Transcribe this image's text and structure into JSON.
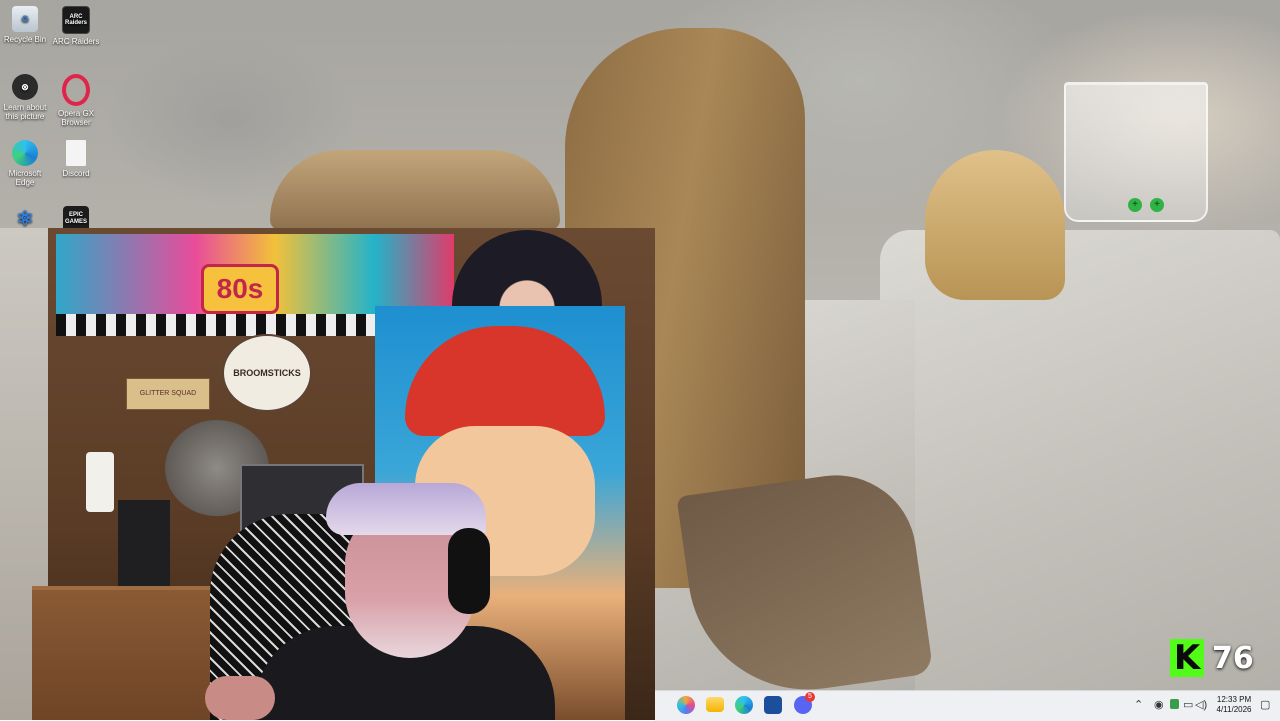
{
  "desktop": {
    "icons": [
      {
        "name": "recycle-bin",
        "label": "Recycle Bin"
      },
      {
        "name": "arc-raiders",
        "label": "ARC Raiders",
        "art": "ARC Raiders"
      },
      {
        "name": "learn-about-picture",
        "label": "Learn about this picture"
      },
      {
        "name": "opera-gx",
        "label": "Opera GX Browser"
      },
      {
        "name": "microsoft-edge",
        "label": "Microsoft Edge"
      },
      {
        "name": "discord",
        "label": "Discord"
      },
      {
        "name": "epic-games",
        "label": "EPIC GAMES"
      }
    ]
  },
  "webcam": {
    "banner_text": "80s",
    "sign_text": "BROOMSTICKS",
    "small_sign_text": "GLITTER SQUAD"
  },
  "kick_widget": {
    "viewer_count": "76",
    "logo_letter": "K"
  },
  "taskbar": {
    "apps": [
      "copilot-icon",
      "file-explorer-icon",
      "edge-icon",
      "store-icon",
      "discord-icon"
    ],
    "discord_badge": "5",
    "time": "12:33 PM",
    "date": "4/11/2026"
  },
  "colors": {
    "kick_green": "#53fc18",
    "taskbar_bg": "#eef0f4"
  }
}
